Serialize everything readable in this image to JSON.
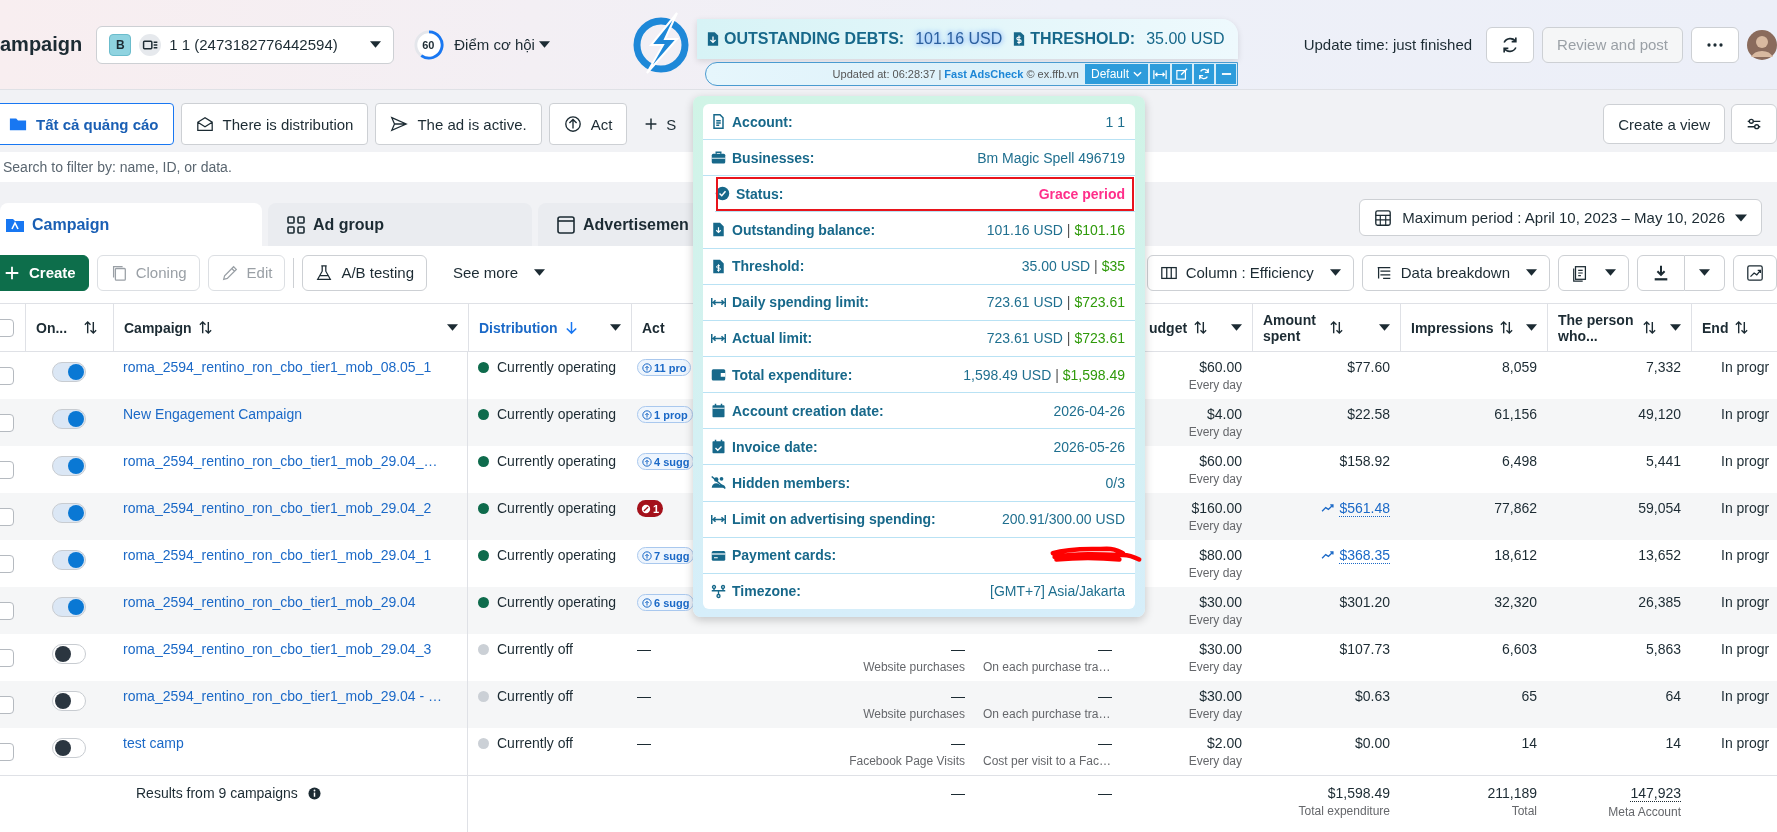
{
  "header": {
    "title": "ampaign",
    "account": {
      "badge": "B",
      "name": "1 1 (2473182776442594)"
    },
    "opportunity": {
      "score": "60",
      "label": "Điểm cơ hội"
    },
    "update_time": "Update time: just finished",
    "review_button": {
      "label": "Review and post",
      "disabled": true
    }
  },
  "debt_widget": {
    "outstanding_label": "OUTSTANDING DEBTS:",
    "outstanding_value": "101.16 USD",
    "threshold_label": "THRESHOLD:",
    "threshold_value": "35.00 USD",
    "updated": "Updated at: 06:28:37 | **Fast AdsCheck** © ex.ffb.vn",
    "preset": "Default"
  },
  "filter_tabs": [
    {
      "label": "Tất cả quảng cáo",
      "selected": true
    },
    {
      "label": "There is distribution",
      "selected": false
    },
    {
      "label": "The ad is active.",
      "selected": false
    },
    {
      "label": "Act",
      "selected": false
    },
    {
      "label": "S",
      "selected": false
    }
  ],
  "create_view": "Create a view",
  "search": {
    "placeholder": "Search to filter by: name, ID, or data."
  },
  "level_tabs": [
    {
      "label": "Campaign",
      "selected": true
    },
    {
      "label": "Ad group",
      "selected": false
    },
    {
      "label": "Advertisemen",
      "selected": false
    }
  ],
  "date_range": "Maximum period : April 10, 2023 – May 10, 2026",
  "toolbar": {
    "left": [
      {
        "label": "Create",
        "kind": "primary",
        "disabled": false
      },
      {
        "label": "Cloning",
        "kind": "copy",
        "disabled": true
      },
      {
        "label": "Edit",
        "kind": "edit",
        "disabled": true
      },
      {
        "label": "A/B testing",
        "kind": "flask",
        "disabled": false
      },
      {
        "label": "See more",
        "kind": "menu",
        "disabled": false
      }
    ],
    "column_button": "Column : Efficiency",
    "breakdown_button": "Data breakdown"
  },
  "table": {
    "all_checked": false,
    "columns": [
      {
        "label": "On...",
        "kind": "toggle",
        "sortable": true,
        "menu": false,
        "sorted": false
      },
      {
        "label": "Campaign",
        "kind": "name",
        "sortable": true,
        "menu": true,
        "sorted": false
      },
      {
        "label": "Distribution",
        "kind": "status",
        "sortable": true,
        "menu": true,
        "sorted": true
      },
      {
        "label": "Act",
        "kind": "act",
        "sortable": false,
        "menu": false,
        "sorted": false
      },
      {
        "label": "udget",
        "kind": "budget",
        "sortable": true,
        "menu": true,
        "sorted": false
      },
      {
        "label": "Amount spent",
        "kind": "amount",
        "sortable": true,
        "menu": true,
        "sorted": false
      },
      {
        "label": "Impressions",
        "kind": "impressions",
        "sortable": true,
        "menu": true,
        "sorted": false
      },
      {
        "label": "The person who...",
        "kind": "reach",
        "sortable": true,
        "menu": true,
        "sorted": false
      },
      {
        "label": "End",
        "kind": "end",
        "sortable": true,
        "menu": false,
        "sorted": false
      }
    ],
    "rows": [
      {
        "checked": false,
        "on": true,
        "name": "roma_2594_rentino_ron_cbo_tier1_mob_08.05_1",
        "status": "Currently operating",
        "active": true,
        "act": {
          "text": "11 pro",
          "kind": "recommendation"
        },
        "budget": "$60.00",
        "budget_period": "Every day",
        "spent": "$77.60",
        "spent_trend": false,
        "impressions": "8,059",
        "reach": "7,332",
        "end": "In progr"
      },
      {
        "checked": false,
        "on": true,
        "name": "New Engagement Campaign",
        "status": "Currently operating",
        "active": true,
        "act": {
          "text": "1 prop",
          "kind": "recommendation"
        },
        "budget": "$4.00",
        "budget_period": "Every day",
        "spent": "$22.58",
        "spent_trend": false,
        "impressions": "61,156",
        "reach": "49,120",
        "end": "In progr"
      },
      {
        "checked": false,
        "on": true,
        "name": "roma_2594_rentino_ron_cbo_tier1_mob_29.04_…",
        "status": "Currently operating",
        "active": true,
        "act": {
          "text": "4 sugg",
          "kind": "recommendation"
        },
        "budget": "$60.00",
        "budget_period": "Every day",
        "spent": "$158.92",
        "spent_trend": false,
        "impressions": "6,498",
        "reach": "5,441",
        "end": "In progr"
      },
      {
        "checked": false,
        "on": true,
        "name": "roma_2594_rentino_ron_cbo_tier1_mob_29.04_2",
        "status": "Currently operating",
        "active": true,
        "act": {
          "text": "1",
          "kind": "error"
        },
        "budget": "$160.00",
        "budget_period": "Every day",
        "spent": "$561.48",
        "spent_trend": true,
        "impressions": "77,862",
        "reach": "59,054",
        "end": "In progr"
      },
      {
        "checked": false,
        "on": true,
        "name": "roma_2594_rentino_ron_cbo_tier1_mob_29.04_1",
        "status": "Currently operating",
        "active": true,
        "act": {
          "text": "7 sugg",
          "kind": "recommendation"
        },
        "budget": "$80.00",
        "budget_period": "Every day",
        "spent": "$368.35",
        "spent_trend": true,
        "impressions": "18,612",
        "reach": "13,652",
        "end": "In progr"
      },
      {
        "checked": false,
        "on": true,
        "name": "roma_2594_rentino_ron_cbo_tier1_mob_29.04",
        "status": "Currently operating",
        "active": true,
        "act": {
          "text": "6 sugg",
          "kind": "recommendation"
        },
        "budget": "$30.00",
        "budget_period": "Every day",
        "spent": "$301.20",
        "spent_trend": false,
        "impressions": "32,320",
        "reach": "26,385",
        "end": "In progr"
      },
      {
        "checked": false,
        "on": false,
        "name": "roma_2594_rentino_ron_cbo_tier1_mob_29.04_3",
        "status": "Currently off",
        "active": false,
        "act": {
          "text": "—",
          "kind": "none"
        },
        "attribution": {
          "value": "—",
          "sub": "Website purchases"
        },
        "bid": {
          "value": "—",
          "sub": "On each purchase tra…"
        },
        "budget": "$30.00",
        "budget_period": "Every day",
        "spent": "$107.73",
        "spent_trend": false,
        "impressions": "6,603",
        "reach": "5,863",
        "end": "In progr"
      },
      {
        "checked": false,
        "on": false,
        "name": "roma_2594_rentino_ron_cbo_tier1_mob_29.04 - …",
        "status": "Currently off",
        "active": false,
        "act": {
          "text": "—",
          "kind": "none"
        },
        "attribution": {
          "value": "—",
          "sub": "Website purchases"
        },
        "bid": {
          "value": "—",
          "sub": "On each purchase tra…"
        },
        "budget": "$30.00",
        "budget_period": "Every day",
        "spent": "$0.63",
        "spent_trend": false,
        "impressions": "65",
        "reach": "64",
        "end": "In progr"
      },
      {
        "checked": false,
        "on": false,
        "name": "test camp",
        "status": "Currently off",
        "active": false,
        "act": {
          "text": "—",
          "kind": "none"
        },
        "attribution": {
          "value": "—",
          "sub": "Facebook Page Visits"
        },
        "bid": {
          "value": "—",
          "sub": "Cost per visit to a Fac…"
        },
        "budget": "$2.00",
        "budget_period": "Every day",
        "spent": "$0.00",
        "spent_trend": false,
        "impressions": "14",
        "reach": "14",
        "end": "In progr"
      }
    ],
    "footer": {
      "summary": "Results from 9 campaigns",
      "attribution": "—",
      "bid": "—",
      "spent": "$1,598.49",
      "spent_sub": "Total expenditure",
      "impressions": "211,189",
      "impressions_sub": "Total",
      "reach": "147,923",
      "reach_sub": "Meta Account"
    }
  },
  "account_popup": {
    "rows": [
      {
        "label": "Account:",
        "value": "1 1",
        "kind": "plain",
        "highlighted": false
      },
      {
        "label": "Businesses:",
        "value": "Bm Magic Spell 496719",
        "kind": "plain",
        "highlighted": false
      },
      {
        "label": "Status:",
        "value": "Grace period",
        "kind": "status",
        "highlighted": true
      },
      {
        "label": "Outstanding balance:",
        "value": "101.16 USD",
        "separator": "|",
        "alt": "$101.16",
        "kind": "money",
        "highlighted": false
      },
      {
        "label": "Threshold:",
        "value": "35.00 USD",
        "separator": "|",
        "alt": "$35",
        "kind": "money",
        "highlighted": false
      },
      {
        "label": "Daily spending limit:",
        "value": "723.61 USD",
        "separator": "|",
        "alt": "$723.61",
        "kind": "money",
        "highlighted": false
      },
      {
        "label": "Actual limit:",
        "value": "723.61 USD",
        "separator": "|",
        "alt": "$723.61",
        "kind": "money",
        "highlighted": false
      },
      {
        "label": "Total expenditure:",
        "value": "1,598.49 USD",
        "separator": "|",
        "alt": "$1,598.49",
        "kind": "money",
        "highlighted": false
      },
      {
        "label": "Account creation date:",
        "value": "2026-04-26",
        "kind": "plain",
        "highlighted": false
      },
      {
        "label": "Invoice date:",
        "value": "2026-05-26",
        "kind": "plain",
        "highlighted": false
      },
      {
        "label": "Hidden members:",
        "value": "0/3",
        "kind": "plain",
        "highlighted": false
      },
      {
        "label": "Limit on advertising spending:",
        "value": "200.91/300.00 USD",
        "kind": "plain",
        "highlighted": false
      },
      {
        "label": "Payment cards:",
        "kind": "redacted",
        "highlighted": false
      },
      {
        "label": "Timezone:",
        "value": "[GMT+7] Asia/Jakarta",
        "kind": "plain",
        "highlighted": false
      }
    ]
  }
}
